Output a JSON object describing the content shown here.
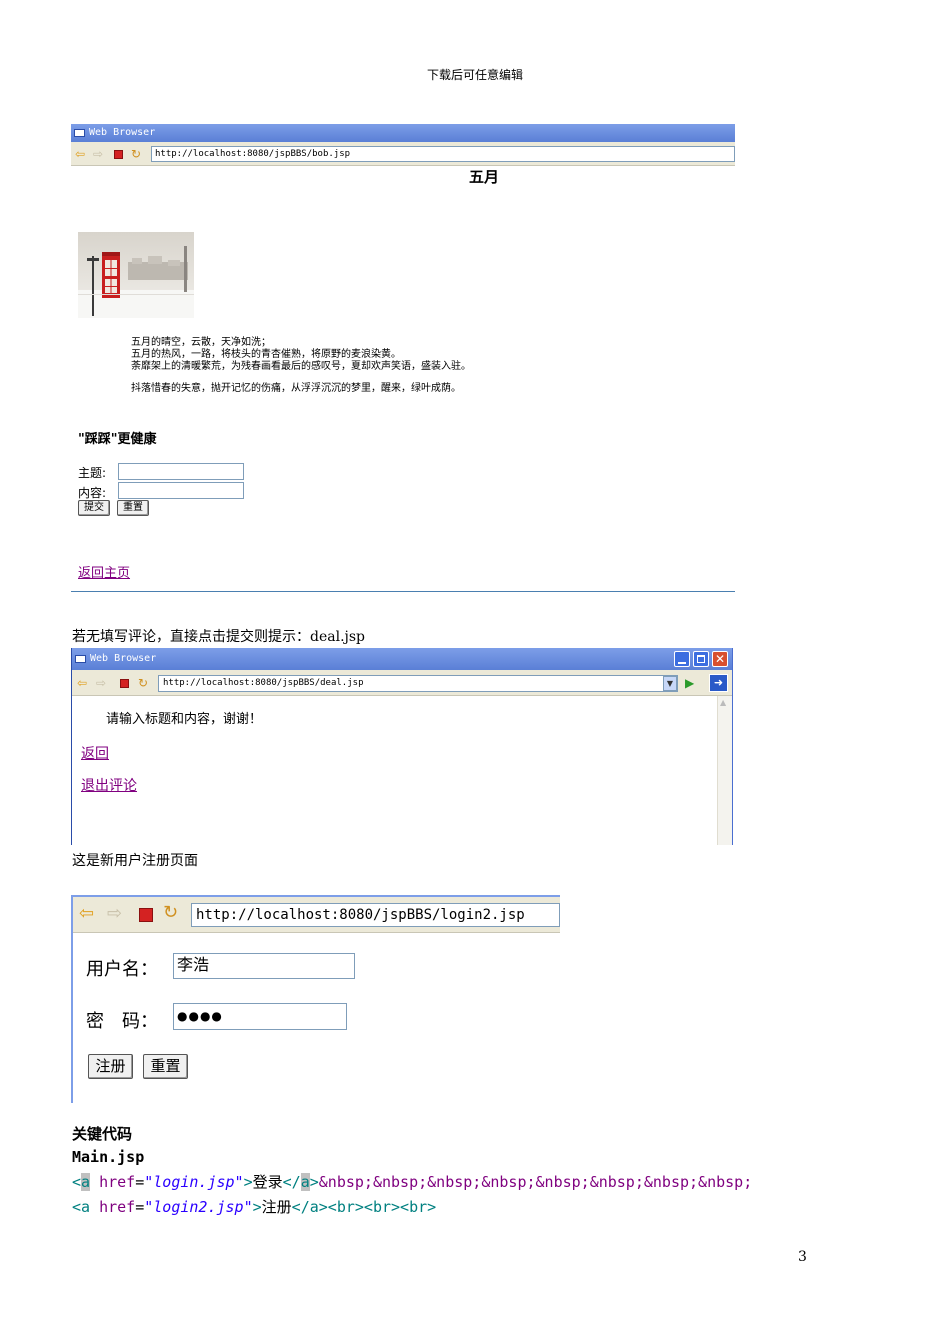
{
  "header": {
    "text": "下载后可任意编辑"
  },
  "browser1": {
    "title": "Web Browser",
    "url": "http://localhost:8080/jspBBS/bob.jsp",
    "heading": "五月",
    "poem": [
      "五月的晴空，云散，天净如洗；",
      "五月的热风，一路，将枝头的青杏催熟，将原野的麦浪染黄。",
      "荼靡架上的清暖繁荒，为残春画看最后的感叹号，夏却欢声笑语，盛装入驻。",
      "抖落惜春的失意，抛开记忆的伤痛，从浮浮沉沉的梦里，醒来，绿叶成荫。"
    ],
    "slogan": "\"踩踩\"更健康",
    "subject_label": "主题:",
    "content_label": "内容:",
    "submit_label": "提交",
    "reset_label": "重置",
    "home_link": "返回主页"
  },
  "para1": "若无填写评论，直接点击提交则提示：deal.jsp",
  "browser2": {
    "title": "Web Browser",
    "url": "http://localhost:8080/jspBBS/deal.jsp",
    "message": "请输入标题和内容，谢谢！",
    "back_link": "返回",
    "exit_link": "退出评论"
  },
  "para2": "这是新用户注册页面",
  "browser3": {
    "url": "http://localhost:8080/jspBBS/login2.jsp",
    "username_label": "用户名：",
    "username_value": "李浩",
    "password_label": "密　码：",
    "password_value": "●●●●",
    "register_label": "注册",
    "reset_label": "重置"
  },
  "section": {
    "heading": "关键代码",
    "filename": "Main.jsp",
    "code_line1": {
      "lt1": "<",
      "a1": "a",
      "attr": " href",
      "eq": "=",
      "val": "\"login.jsp\"",
      "gt": ">",
      "text": "登录",
      "close_lt": "</",
      "a2": "a",
      "close_gt": ">",
      "entities": "&nbsp;&nbsp;&nbsp;&nbsp;&nbsp;&nbsp;&nbsp;&nbsp;"
    },
    "code_line2": {
      "open": "<a",
      "attr": " href",
      "eq": "=",
      "val": "\"login2.jsp\"",
      "gt": ">",
      "text": "注册",
      "rest": "</a><br><br><br>"
    }
  },
  "page_number": "3"
}
